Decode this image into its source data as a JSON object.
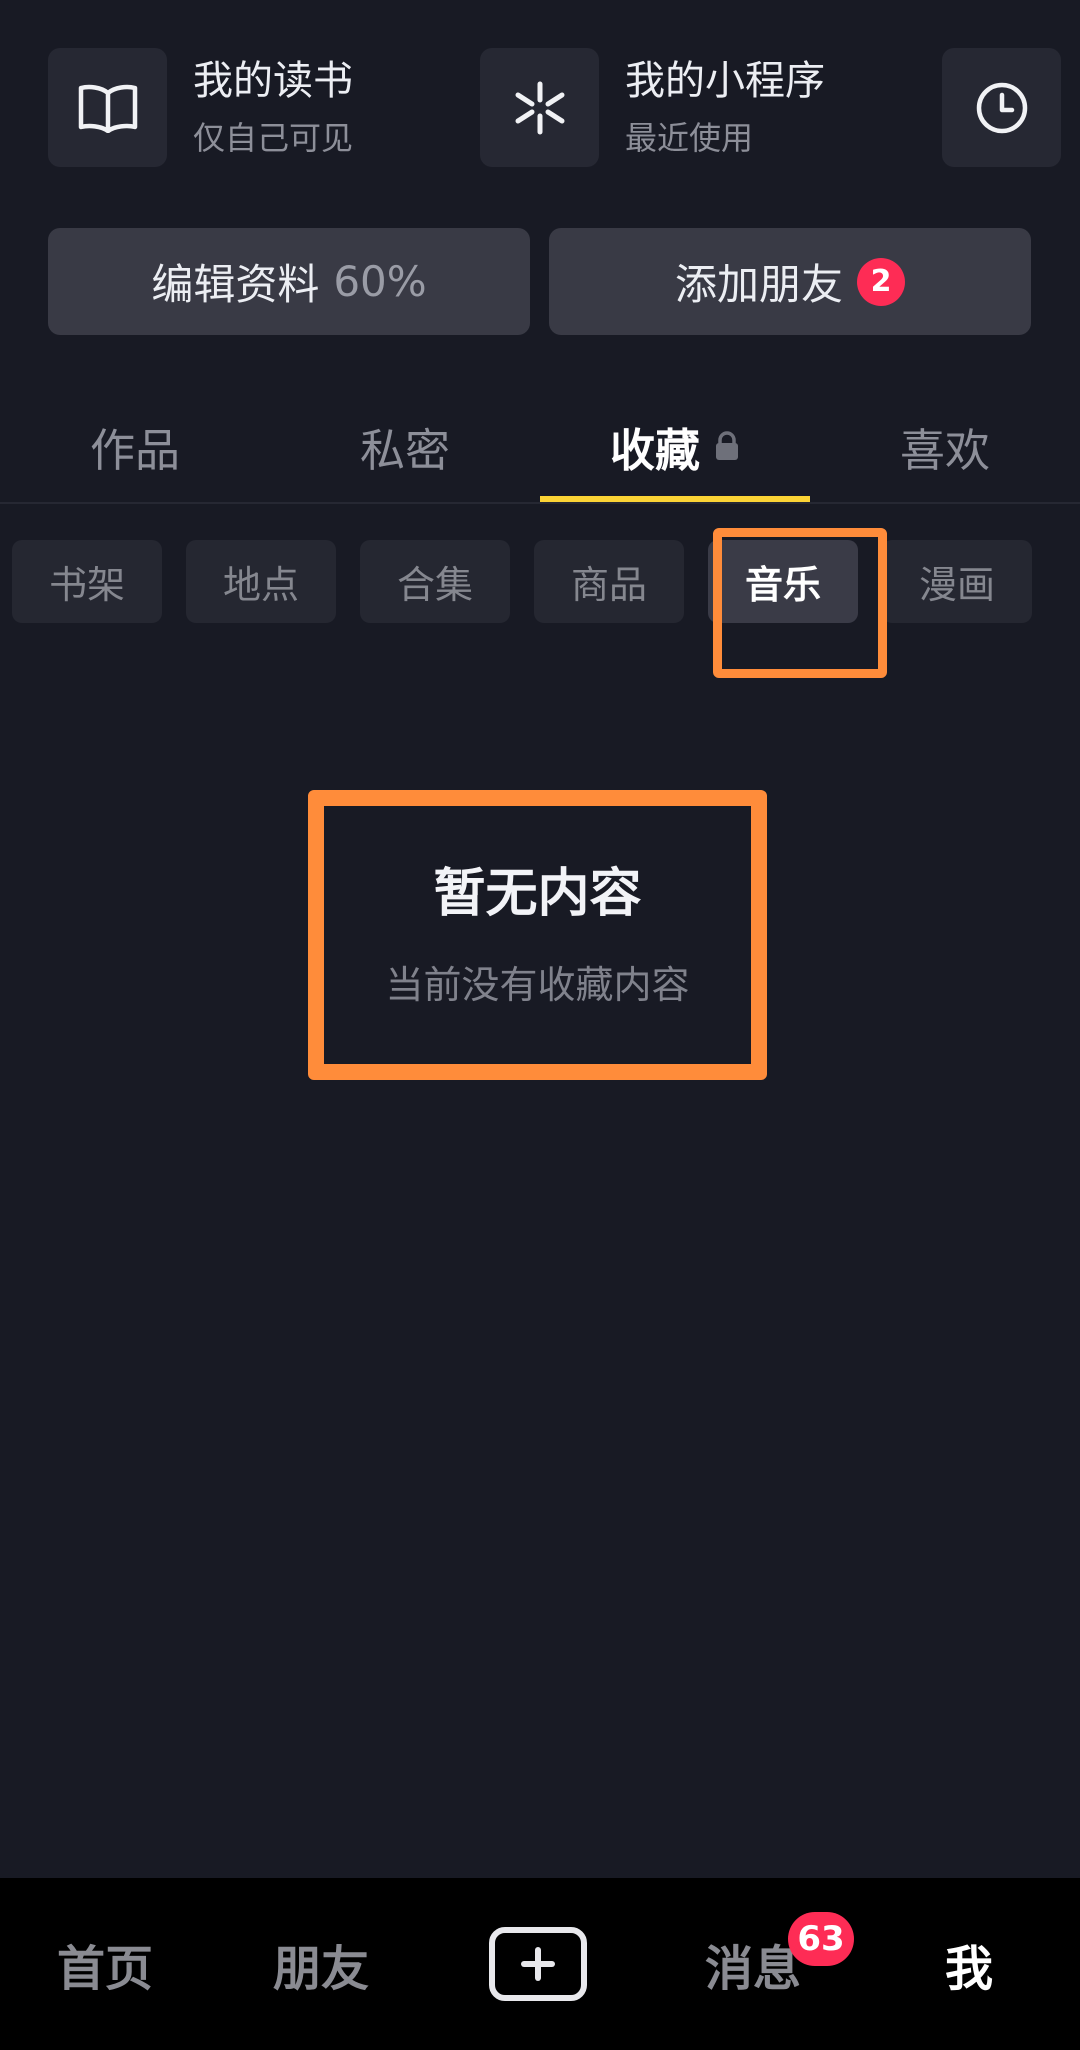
{
  "shortcuts": {
    "reading": {
      "title": "我的读书",
      "subtitle": "仅自己可见",
      "icon": "book-icon"
    },
    "miniapp": {
      "title": "我的小程序",
      "subtitle": "最近使用",
      "icon": "miniapp-icon"
    },
    "history": {
      "icon": "clock-icon"
    }
  },
  "actions": {
    "edit_profile": {
      "label": "编辑资料",
      "progress": "60%"
    },
    "add_friends": {
      "label": "添加朋友",
      "badge": "2"
    }
  },
  "tabs": [
    {
      "label": "作品",
      "active": false
    },
    {
      "label": "私密",
      "active": false
    },
    {
      "label": "收藏",
      "active": true,
      "icon": "lock-icon"
    },
    {
      "label": "喜欢",
      "active": false
    }
  ],
  "chips": [
    {
      "label": "书架",
      "active": false
    },
    {
      "label": "地点",
      "active": false
    },
    {
      "label": "合集",
      "active": false
    },
    {
      "label": "商品",
      "active": false
    },
    {
      "label": "音乐",
      "active": true
    },
    {
      "label": "漫画",
      "active": false
    }
  ],
  "empty_state": {
    "title": "暂无内容",
    "subtitle": "当前没有收藏内容"
  },
  "bottom_nav": {
    "home": "首页",
    "friends": "朋友",
    "messages": "消息",
    "messages_badge": "63",
    "me": "我",
    "active": "me"
  },
  "colors": {
    "background": "#181a24",
    "accent_underline": "#fbd335",
    "badge": "#fe2c55",
    "highlight": "#ff8c3a"
  }
}
